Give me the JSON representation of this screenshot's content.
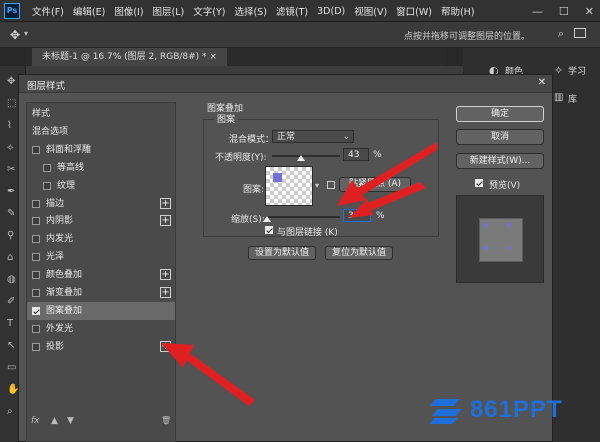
{
  "app": {
    "logo": "Ps",
    "menus": [
      "文件(F)",
      "编辑(E)",
      "图像(I)",
      "图层(L)",
      "文字(Y)",
      "选择(S)",
      "滤镜(T)",
      "3D(D)",
      "视图(V)",
      "窗口(W)",
      "帮助(H)"
    ],
    "window_controls": [
      "—",
      "☐",
      "✕"
    ]
  },
  "options_bar": {
    "hint": "点按并拖移可调整图层的位置。"
  },
  "document_tab": {
    "title": "未标题-1 @ 16.7% (图层 2, RGB/8#) *",
    "close": "×"
  },
  "right_panel": {
    "color": "颜色",
    "learn": "学习",
    "library": "库"
  },
  "dialog": {
    "title": "图层样式",
    "close": "✕",
    "list": [
      {
        "label": "样式",
        "check": null,
        "plus": false
      },
      {
        "label": "混合选项",
        "check": null,
        "plus": false
      },
      {
        "label": "斜面和浮雕",
        "check": false,
        "plus": false
      },
      {
        "label": "等高线",
        "check": false,
        "plus": false,
        "indent": true
      },
      {
        "label": "纹理",
        "check": false,
        "plus": false,
        "indent": true
      },
      {
        "label": "描边",
        "check": false,
        "plus": true
      },
      {
        "label": "内阴影",
        "check": false,
        "plus": true
      },
      {
        "label": "内发光",
        "check": false,
        "plus": false
      },
      {
        "label": "光泽",
        "check": false,
        "plus": false
      },
      {
        "label": "颜色叠加",
        "check": false,
        "plus": true
      },
      {
        "label": "渐变叠加",
        "check": false,
        "plus": true
      },
      {
        "label": "图案叠加",
        "check": true,
        "plus": false,
        "selected": true
      },
      {
        "label": "外发光",
        "check": false,
        "plus": false
      },
      {
        "label": "投影",
        "check": false,
        "plus": true
      }
    ],
    "footer_icons": [
      "fx",
      "▲",
      "▼",
      "🗑"
    ],
    "section": "图案叠加",
    "group": "图案",
    "blend_mode_label": "混合模式：",
    "blend_mode": "正常",
    "opacity_label": "不透明度(Y):",
    "opacity": "43",
    "opacity_unit": "%",
    "opacity_level": 0.43,
    "pattern_label": "图案:",
    "snap_button": "贴紧原点 (A)",
    "scale_label": "缩放(S):",
    "scale": "3",
    "scale_unit": "%",
    "scale_level": 0.01,
    "link_label": "与图层链接 (K)",
    "link_checked": true,
    "set_default": "设置为默认值",
    "reset_default": "复位为默认值",
    "ok": "确定",
    "cancel": "取消",
    "new_style": "新建样式(W)...",
    "preview": "预览(V)",
    "preview_checked": true
  },
  "watermark": "861PPT",
  "colors": {
    "arrow": "#e02020",
    "accent": "#1e6fd9"
  }
}
